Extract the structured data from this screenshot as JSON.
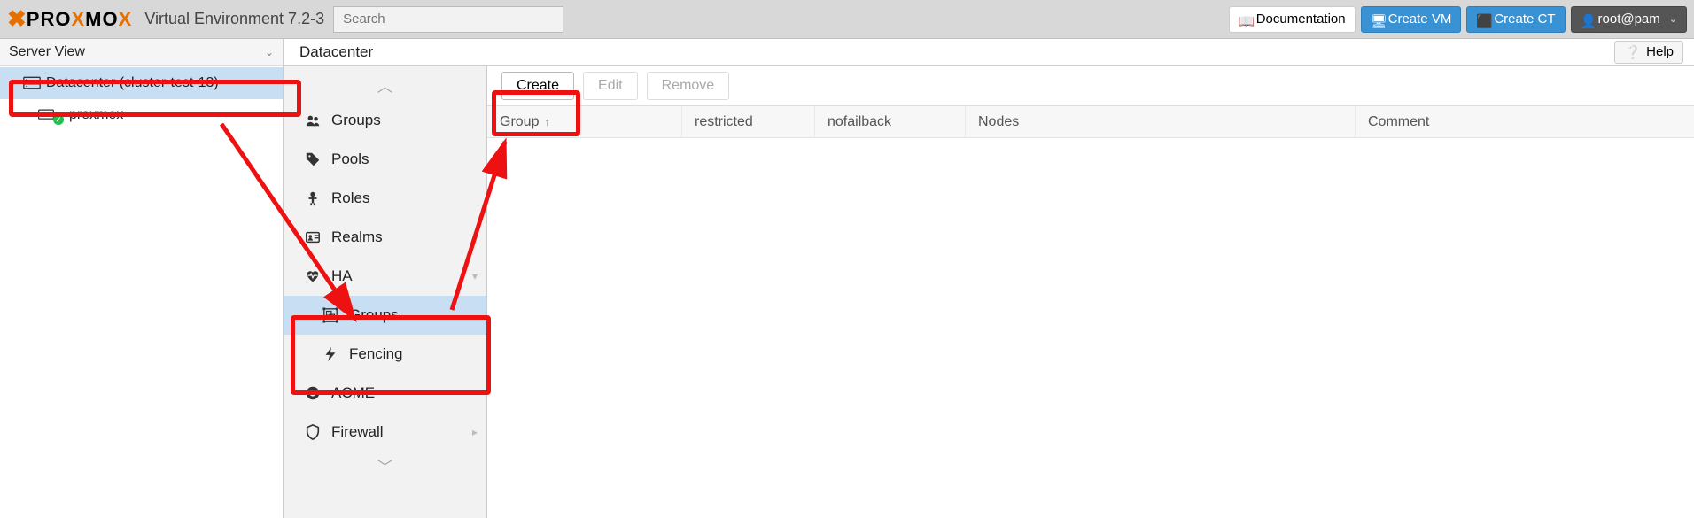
{
  "header": {
    "logo_prefix": "PRO",
    "logo_mid": "X",
    "logo_suffix": "MO",
    "logo_end": "X",
    "env": "Virtual Environment 7.2-3",
    "search_placeholder": "Search",
    "buttons": {
      "doc": "Documentation",
      "create_vm": "Create VM",
      "create_ct": "Create CT",
      "user": "root@pam"
    }
  },
  "left": {
    "view_label": "Server View",
    "tree": {
      "datacenter": "Datacenter (cluster-test-13)",
      "node": "proxmox"
    }
  },
  "breadcrumb": "Datacenter",
  "help": "Help",
  "submenu": {
    "items": [
      {
        "key": "groups_perm",
        "label": "Groups"
      },
      {
        "key": "pools",
        "label": "Pools"
      },
      {
        "key": "roles",
        "label": "Roles"
      },
      {
        "key": "realms",
        "label": "Realms"
      },
      {
        "key": "ha",
        "label": "HA",
        "expandable": true
      },
      {
        "key": "ha_groups",
        "label": "Groups",
        "sub": true,
        "selected": true
      },
      {
        "key": "fencing",
        "label": "Fencing",
        "sub": true
      },
      {
        "key": "acme",
        "label": "ACME"
      },
      {
        "key": "firewall",
        "label": "Firewall",
        "expandable": true
      }
    ]
  },
  "toolbar": {
    "create": "Create",
    "edit": "Edit",
    "remove": "Remove"
  },
  "grid": {
    "cols": {
      "group": "Group",
      "restricted": "restricted",
      "nofailback": "nofailback",
      "nodes": "Nodes",
      "comment": "Comment"
    }
  }
}
